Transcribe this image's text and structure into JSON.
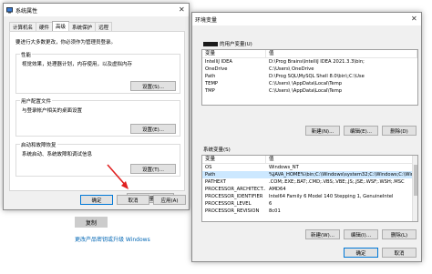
{
  "background": {
    "copy_button": "复制",
    "link": "更改产品密钥或升级 Windows"
  },
  "system_properties": {
    "title": "系统属性",
    "tabs": [
      "计算机名",
      "硬件",
      "高级",
      "系统保护",
      "远程"
    ],
    "admin_note": "要进行大多数更改，你必须作为管理员登录。",
    "performance": {
      "title": "性能",
      "desc": "视觉效果，处理器计划，内存使用，以及虚拟内存",
      "button": "设置(S)..."
    },
    "user_profiles": {
      "title": "用户配置文件",
      "desc": "与登录帐户相关的桌面设置",
      "button": "设置(E)..."
    },
    "startup_recovery": {
      "title": "启动和故障恢复",
      "desc": "系统启动、系统故障和调试信息",
      "button": "设置(T)..."
    },
    "env_button": "环境变量(N)...",
    "ok": "确定",
    "cancel": "取消",
    "apply": "应用(A)"
  },
  "env_vars": {
    "title": "环境变量",
    "user_section": "的用户变量(U)",
    "columns": [
      "变量",
      "值"
    ],
    "user_vars": [
      {
        "name": "IntelliJ IDEA",
        "value": "D:\\Prog          Brains\\IntelliJ IDEA 2021.3.3\\bin;"
      },
      {
        "name": "OneDrive",
        "value": "C:\\Users\\           OneDrive"
      },
      {
        "name": "Path",
        "value": "D:\\Prog           SQL\\MySQL Shell 8.0\\bin\\;C:\\Use"
      },
      {
        "name": "TEMP",
        "value": "C:\\Users\\           \\AppData\\Local\\Temp"
      },
      {
        "name": "TMP",
        "value": "C:\\Users\\           \\AppData\\Local\\Temp"
      }
    ],
    "user_buttons": [
      "新建(N)...",
      "编辑(E)...",
      "删除(D)"
    ],
    "system_section": "系统变量(S)",
    "system_vars": [
      {
        "name": "OS",
        "value": "Windows_NT"
      },
      {
        "name": "Path",
        "value": "%JAVA_HOME%\\bin;C:\\Windows\\system32;C:\\Windows;C:\\Windo"
      },
      {
        "name": "PATHEXT",
        "value": ".COM;.EXE;.BAT;.CMD;.VBS;.VBE;.JS;.JSE;.WSF;.WSH;.MSC"
      },
      {
        "name": "PROCESSOR_ARCHITECT...",
        "value": "AMD64"
      },
      {
        "name": "PROCESSOR_IDENTIFIER",
        "value": "Intel64 Family 6 Model 140 Stepping 1, GenuineIntel"
      },
      {
        "name": "PROCESSOR_LEVEL",
        "value": "6"
      },
      {
        "name": "PROCESSOR_REVISION",
        "value": "8c01"
      }
    ],
    "system_buttons": [
      "新建(W)...",
      "编辑(I)...",
      "删除(L)"
    ],
    "ok": "确定",
    "cancel": "取消"
  },
  "colors": {
    "selection": "#cce8ff",
    "arrow": "#e02020",
    "link": "#0066b4"
  }
}
